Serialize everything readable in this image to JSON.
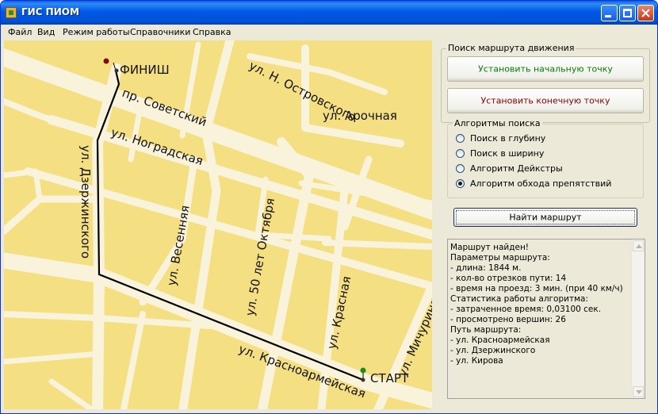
{
  "window": {
    "title": "ГИС ПИОМ"
  },
  "menu": [
    "Файл",
    "Вид",
    "Режим работы",
    "Справочники",
    "Справка"
  ],
  "map": {
    "streets": [
      "ул. Н. Островского",
      "ул. Арочная",
      "пр. Советский",
      "ул. Ноградская",
      "ул. Дзержинского",
      "ул. Весенняя",
      "ул. 50 лет Октября",
      "ул. Красная",
      "ул. Мичурина",
      "ул. Красноармейская"
    ],
    "finish_label": "ФИНИШ",
    "start_label": "СТАРТ",
    "colors": {
      "block": "#f5df83",
      "road": "#faf3dc",
      "route": "#000000",
      "finish_marker": "#7a1010",
      "start_marker": "#1f8a1f"
    }
  },
  "search_group": {
    "title": "Поиск маршрута движения",
    "set_start_label": "Установить начальную точку",
    "set_end_label": "Установить конечную точку",
    "set_start_color": "#0a7a0a",
    "set_end_color": "#8b0000"
  },
  "algorithms": {
    "title": "Алгоритмы поиска",
    "options": [
      {
        "label": "Поиск в глубину",
        "selected": false
      },
      {
        "label": "Поиск в ширину",
        "selected": false
      },
      {
        "label": "Алгоритм Дейкстры",
        "selected": false
      },
      {
        "label": "Алгоритм обхода препятствий",
        "selected": true
      }
    ]
  },
  "find_route_label": "Найти маршрут",
  "result_lines": [
    "Маршрут найден!",
    "Параметры маршрута:",
    "  - длина: 1844 м.",
    "  - кол-во отрезков пути: 14",
    "  - время на проезд: 3 мин. (при 40 км/ч)",
    "Статистика работы алгоритма:",
    "  - затраченное время: 0,03100 сек.",
    "  - просмотрено вершин: 26",
    "Путь маршрута:",
    "  - ул. Красноармейская",
    "  - ул. Дзержинского",
    "  - ул. Кирова"
  ]
}
